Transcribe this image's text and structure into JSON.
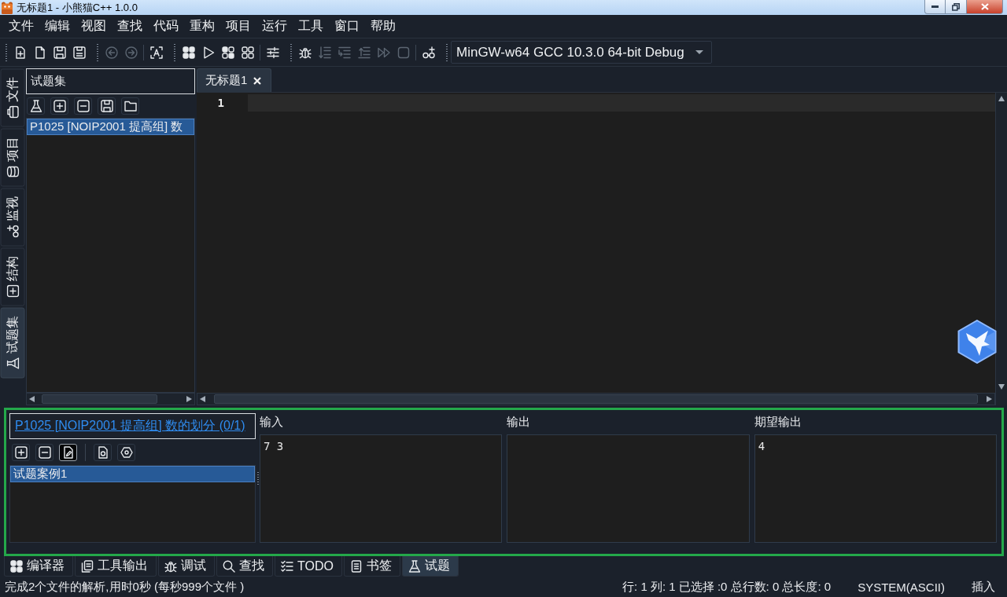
{
  "window": {
    "title": "无标题1 - 小熊猫C++ 1.0.0"
  },
  "menu": [
    "文件",
    "编辑",
    "视图",
    "查找",
    "代码",
    "重构",
    "项目",
    "运行",
    "工具",
    "窗口",
    "帮助"
  ],
  "toolbar": {
    "groups": [
      {
        "items": [
          {
            "kind": "newproject",
            "disabled": false
          },
          {
            "kind": "newfile",
            "disabled": false
          },
          {
            "kind": "save",
            "disabled": false
          },
          {
            "kind": "saveall",
            "disabled": false
          }
        ]
      },
      {
        "items": [
          {
            "kind": "back",
            "disabled": true
          },
          {
            "kind": "forward",
            "disabled": true
          },
          {
            "kind": "separator"
          },
          {
            "kind": "format",
            "disabled": false
          }
        ]
      },
      {
        "items": [
          {
            "kind": "compile",
            "disabled": false
          },
          {
            "kind": "run",
            "disabled": false
          },
          {
            "kind": "compilerun",
            "disabled": false
          },
          {
            "kind": "rebuild",
            "disabled": false
          },
          {
            "kind": "separator"
          },
          {
            "kind": "options",
            "disabled": false
          }
        ]
      },
      {
        "items": [
          {
            "kind": "debug",
            "disabled": false
          },
          {
            "kind": "stepover",
            "disabled": true
          },
          {
            "kind": "stepinto",
            "disabled": true
          },
          {
            "kind": "stepout",
            "disabled": true
          },
          {
            "kind": "continue",
            "disabled": true
          },
          {
            "kind": "stop",
            "disabled": true
          },
          {
            "kind": "separator"
          },
          {
            "kind": "addwatch",
            "disabled": false
          }
        ]
      }
    ],
    "compiler": {
      "value": "MinGW-w64 GCC 10.3.0 64-bit Debug"
    }
  },
  "side_tabs": [
    {
      "label": "文件",
      "kind": "files",
      "selected": false
    },
    {
      "label": "项目",
      "kind": "project",
      "selected": false
    },
    {
      "label": "监视",
      "kind": "watch",
      "selected": false
    },
    {
      "label": "结构",
      "kind": "structure",
      "selected": false
    },
    {
      "label": "试题集",
      "kind": "problemset",
      "selected": true
    }
  ],
  "problem_set": {
    "title": "试题集",
    "tools": [
      {
        "kind": "problem"
      },
      {
        "kind": "add"
      },
      {
        "kind": "remove"
      },
      {
        "kind": "save"
      },
      {
        "kind": "open"
      }
    ],
    "items": [
      {
        "label": "P1025 [NOIP2001 提高组] 数",
        "selected": true
      }
    ]
  },
  "editor": {
    "tabs": [
      {
        "label": "无标题1",
        "selected": true
      }
    ],
    "lines": [
      {
        "number": "1",
        "current": true
      }
    ]
  },
  "problem_panel": {
    "highlighted": true,
    "title": "P1025 [NOIP2001 提高组] 数的划分 (0/1)",
    "tools": [
      {
        "kind": "add",
        "pressed": false
      },
      {
        "kind": "remove",
        "pressed": false
      },
      {
        "kind": "edit",
        "pressed": true
      },
      {
        "kind": "separator"
      },
      {
        "kind": "runcase",
        "pressed": false
      },
      {
        "kind": "settings",
        "pressed": false
      }
    ],
    "cases": [
      {
        "label": "试题案例1",
        "selected": true
      }
    ],
    "columns": [
      {
        "label": "输入",
        "content": "7 3"
      },
      {
        "label": "输出"
      },
      {
        "label": "期望输出",
        "content": "4"
      }
    ]
  },
  "bottom_tabs": [
    {
      "label": "编译器",
      "kind": "compiler",
      "selected": false
    },
    {
      "label": "工具输出",
      "kind": "tooloutput",
      "selected": false
    },
    {
      "label": "调试",
      "kind": "debug",
      "selected": false
    },
    {
      "label": "查找",
      "kind": "search",
      "selected": false
    },
    {
      "label": "TODO",
      "kind": "todo",
      "selected": false
    },
    {
      "label": "书签",
      "kind": "bookmark",
      "selected": false
    },
    {
      "label": "试题",
      "kind": "problem",
      "selected": true
    }
  ],
  "status_bar": {
    "message": "完成2个文件的解析,用时0秒 (每秒999个文件 )",
    "position": "行: 1 列: 1 已选择 :0 总行数: 0 总长度: 0",
    "encoding": "SYSTEM(ASCII)",
    "mode": "插入"
  }
}
